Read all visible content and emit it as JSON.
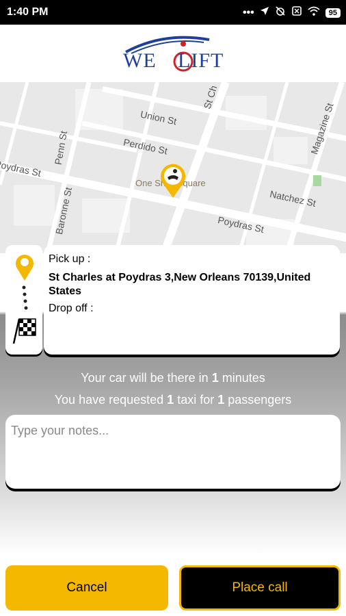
{
  "status_bar": {
    "time": "1:40 PM",
    "battery": "95"
  },
  "brand": {
    "logo_text_left": "WE",
    "logo_text_right": "LIFT"
  },
  "map": {
    "streets": [
      "Union St",
      "Perdido St",
      "St Ch",
      "Penn St",
      "Magazine St",
      "Poydras St",
      "Baronne St",
      "Natchez St",
      "Poydras St"
    ],
    "poi": "One Shell Square"
  },
  "trip": {
    "pickup_label": "Pick up :",
    "pickup_address": "St Charles at Poydras 3,New Orleans 70139,United States",
    "dropoff_label": "Drop off :"
  },
  "info": {
    "eta_prefix": "Your car will be there in ",
    "eta_value": "1",
    "eta_suffix": " minutes",
    "req_prefix": "You have requested ",
    "req_taxis": "1",
    "req_mid": " taxi for ",
    "req_passengers": "1",
    "req_suffix": " passengers"
  },
  "notes": {
    "placeholder": "Type your notes..."
  },
  "buttons": {
    "cancel": "Cancel",
    "place_call": "Place call"
  },
  "colors": {
    "accent": "#f5b800",
    "brand_blue": "#1f3f9a",
    "brand_red": "#d0202a"
  }
}
